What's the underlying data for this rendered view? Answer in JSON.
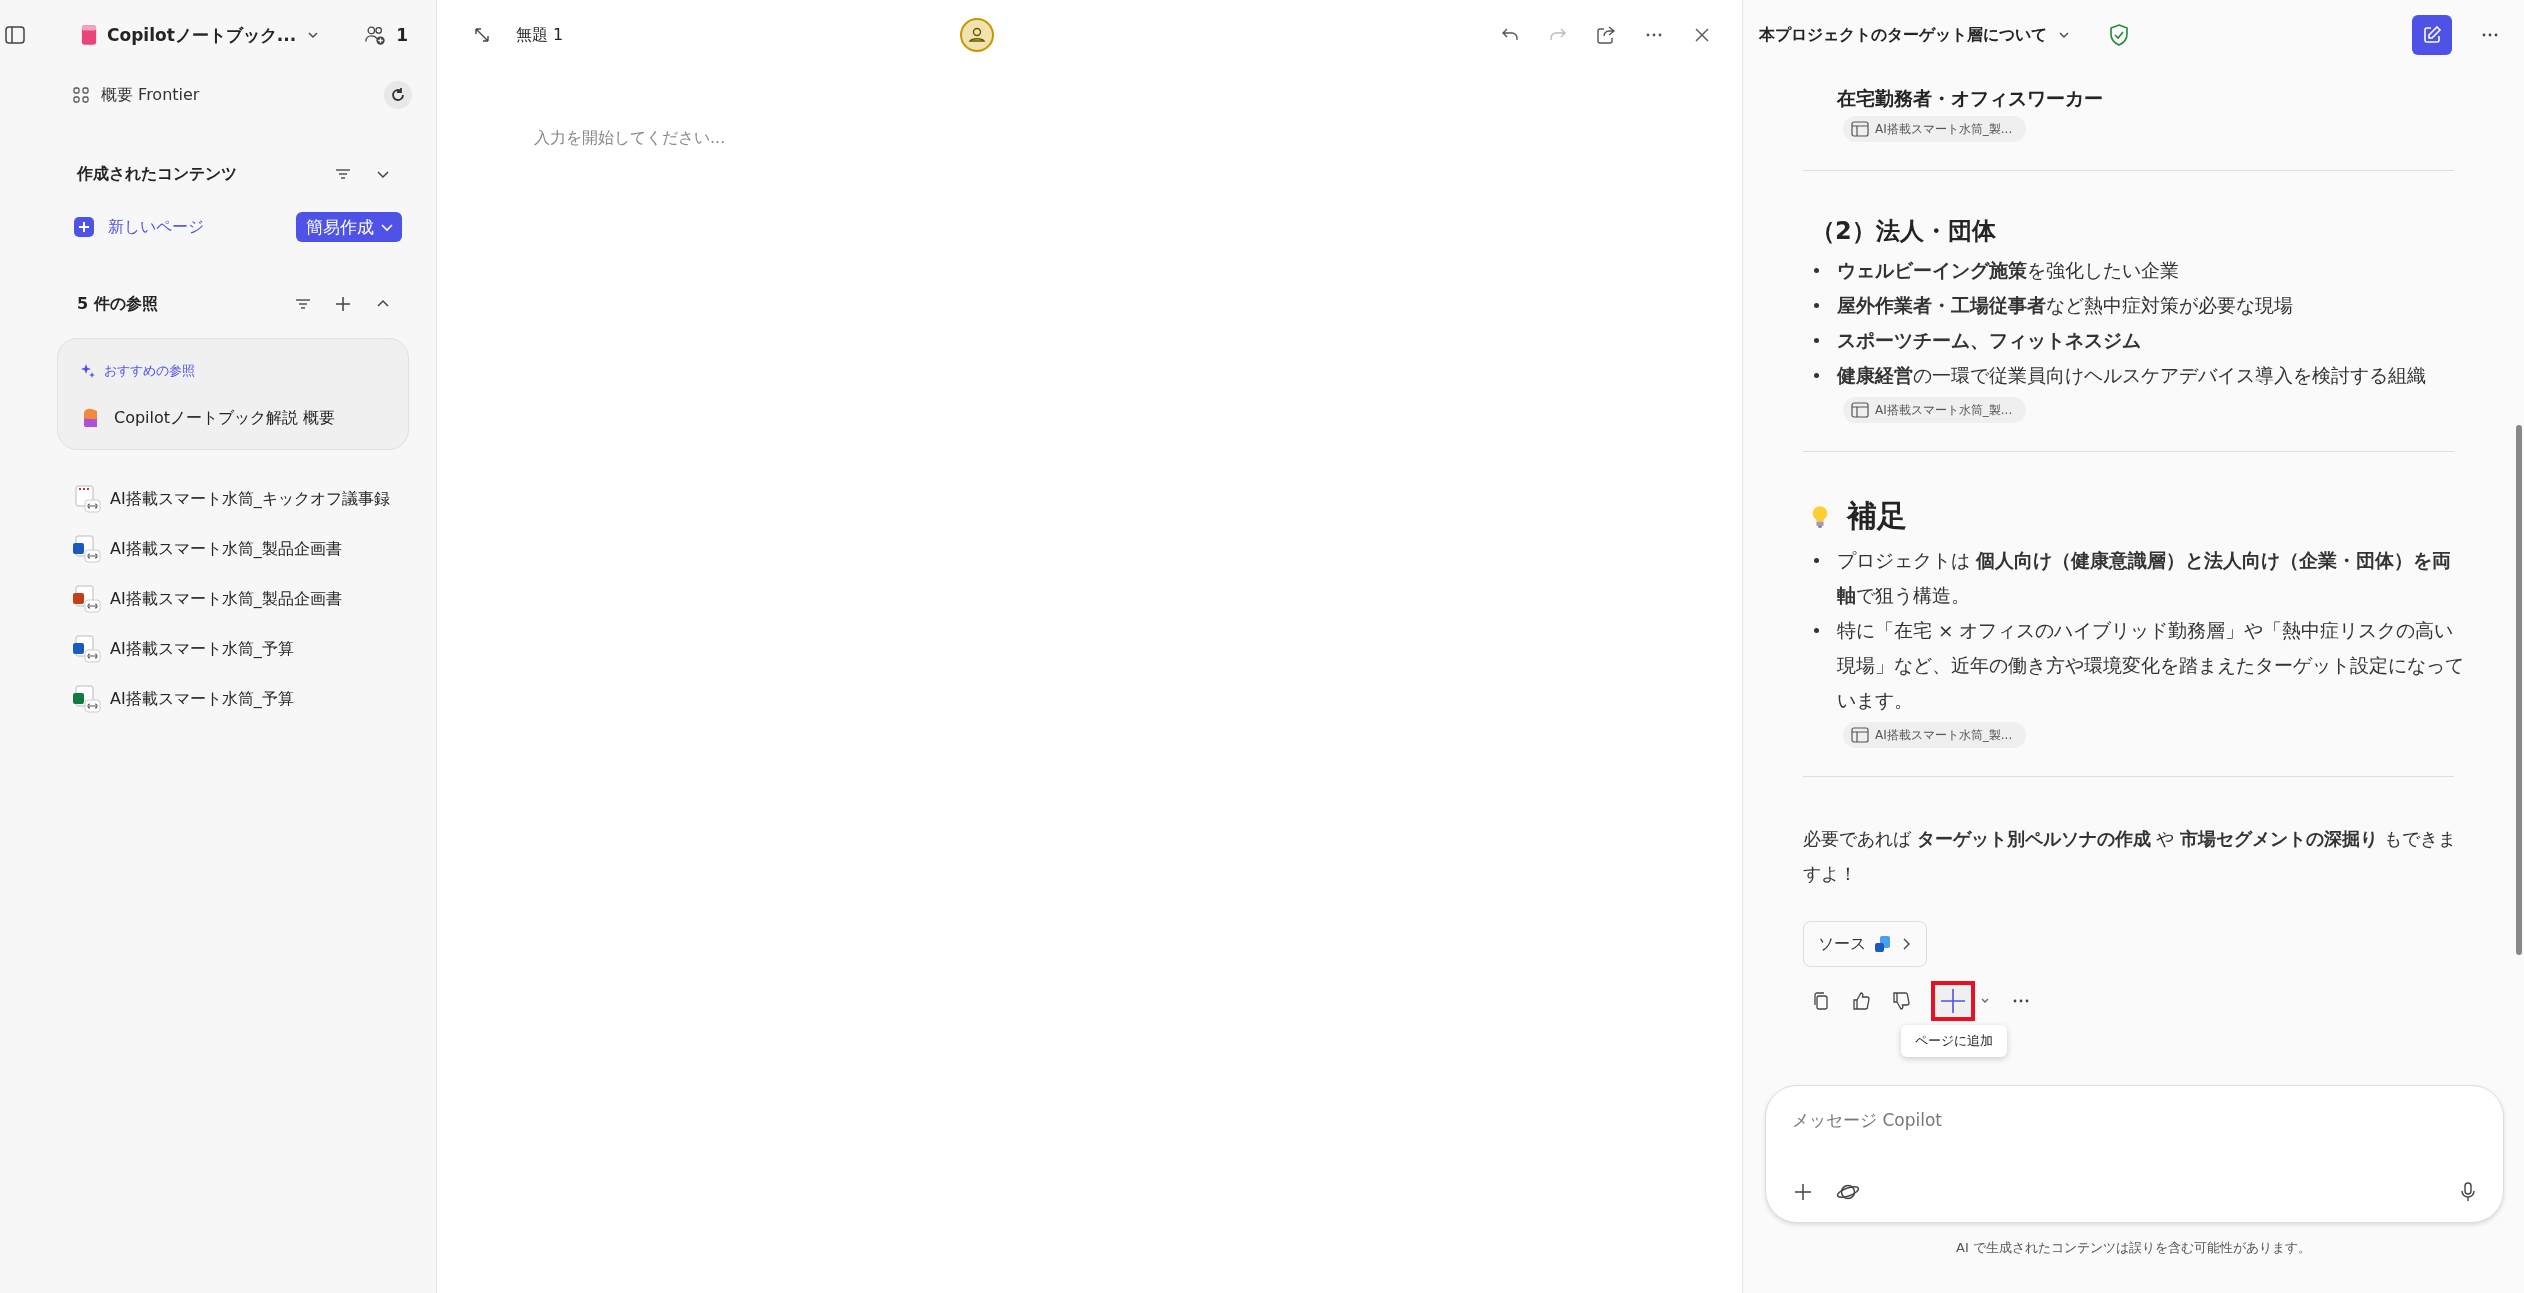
{
  "sidebar": {
    "notebook_title": "Copilotノートブック...",
    "shared_count": "1",
    "overview": "概要 Frontier",
    "created": {
      "title": "作成されたコンテンツ",
      "new_page": "新しいページ",
      "quick_create": "簡易作成"
    },
    "references": {
      "title": "5 件の参照",
      "recommended_label": "おすすめの参照",
      "recommended_item": "Copilotノートブック解説 概要",
      "items": [
        {
          "name": "AI搭載スマート水筒_キックオフ議事録",
          "kind": "notes"
        },
        {
          "name": "AI搭載スマート水筒_製品企画書",
          "kind": "word"
        },
        {
          "name": "AI搭載スマート水筒_製品企画書",
          "kind": "powerpoint"
        },
        {
          "name": "AI搭載スマート水筒_予算",
          "kind": "word"
        },
        {
          "name": "AI搭載スマート水筒_予算",
          "kind": "excel"
        }
      ]
    }
  },
  "page": {
    "title": "無題 1",
    "placeholder": "入力を開始してください..."
  },
  "chat": {
    "title": "本プロジェクトのターゲット層について",
    "sections": [
      {
        "kind": "tail",
        "text": "在宅勤務者・オフィスワーカー",
        "citation": "AI搭載スマート水筒_製..."
      },
      {
        "kind": "list",
        "heading": "（2）法人・団体",
        "bullets": [
          {
            "text": "**ウェルビーイング施策**を強化したい企業",
            "bold": false
          },
          {
            "text": "**屋外作業者・工場従事者**など熱中症対策が必要な現場",
            "bold": false
          },
          {
            "text": "スポーツチーム、フィットネスジム",
            "bold": true
          },
          {
            "text": "**健康経営**の一環で従業員向けヘルスケアデバイス導入を検討する組織",
            "bold": false
          }
        ],
        "citation": "AI搭載スマート水筒_製..."
      },
      {
        "kind": "note",
        "heading": "補足",
        "bullets": [
          {
            "text": "プロジェクトは **個人向け（健康意識層）と法人向け（企業・団体）を両軸**で狙う構造。",
            "bold": false
          },
          {
            "text": "特に「在宅 × オフィスのハイブリッド勤務層」や「熱中症リスクの高い現場」など、近年の働き方や環境変化を踏まえたターゲット設定になっています。",
            "bold": false
          }
        ],
        "citation": "AI搭載スマート水筒_製..."
      }
    ],
    "closing": "必要であれば **ターゲット別ペルソナの作成** や **市場セグメントの深掘り** もできますよ！",
    "source_button": "ソース",
    "actions": [
      {
        "kind": "copy",
        "highlighted": false
      },
      {
        "kind": "like",
        "highlighted": false
      },
      {
        "kind": "dislike",
        "highlighted": false
      },
      {
        "kind": "add",
        "highlighted": true
      },
      {
        "kind": "more",
        "highlighted": false
      }
    ],
    "tooltip": "ページに追加",
    "composer": {
      "placeholder": "メッセージ Copilot"
    },
    "disclaimer": "AI で生成されたコンテンツは誤りを含む可能性があります。"
  }
}
